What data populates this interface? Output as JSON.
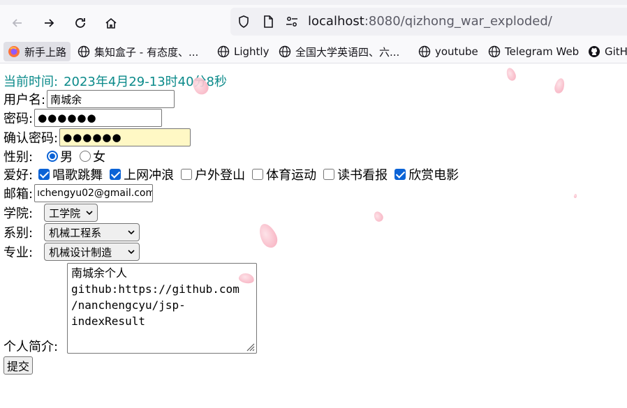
{
  "browser": {
    "url_host": "localhost",
    "url_rest": ":8080/qizhong_war_exploded/",
    "bookmarks": [
      {
        "label": "新手上路",
        "icon": "firefox-icon"
      },
      {
        "label": "集知盒子 - 有态度、...",
        "icon": "globe-icon"
      },
      {
        "label": "Lightly",
        "icon": "globe-icon"
      },
      {
        "label": "全国大学英语四、六...",
        "icon": "globe-icon"
      },
      {
        "label": "youtube",
        "icon": "globe-icon"
      },
      {
        "label": "Telegram Web",
        "icon": "globe-icon"
      },
      {
        "label": "GitH",
        "icon": "github-icon"
      }
    ]
  },
  "form": {
    "time_label": "当前时间:",
    "time_value": "2023年4月29-13时40分8秒",
    "username_label": "用户名:",
    "username_value": "南城余",
    "password_label": "密码:",
    "password_mask": "●●●●●●",
    "confirm_label": "确认密码:",
    "confirm_mask": "●●●●●●",
    "gender_label": "性别:",
    "gender_male": "男",
    "gender_female": "女",
    "hobby_label": "爱好:",
    "hobbies": [
      {
        "label": "唱歌跳舞",
        "checked": true
      },
      {
        "label": "上网冲浪",
        "checked": true
      },
      {
        "label": "户外登山",
        "checked": false
      },
      {
        "label": "体育运动",
        "checked": false
      },
      {
        "label": "读书看报",
        "checked": false
      },
      {
        "label": "欣赏电影",
        "checked": true
      }
    ],
    "email_label": "邮箱:",
    "email_value": "ıchengyu02@gmail.com",
    "college_label": "学院:",
    "college_value": "工学院",
    "department_label": "系别:",
    "department_value": "机械工程系",
    "major_label": "专业:",
    "major_value": "机械设计制造",
    "intro_label": "个人简介:",
    "intro_lines": [
      "南城余个人",
      "github:https://github.com",
      "/nanchengcyu/jsp-",
      "indexResult"
    ],
    "submit_label": "提交"
  }
}
